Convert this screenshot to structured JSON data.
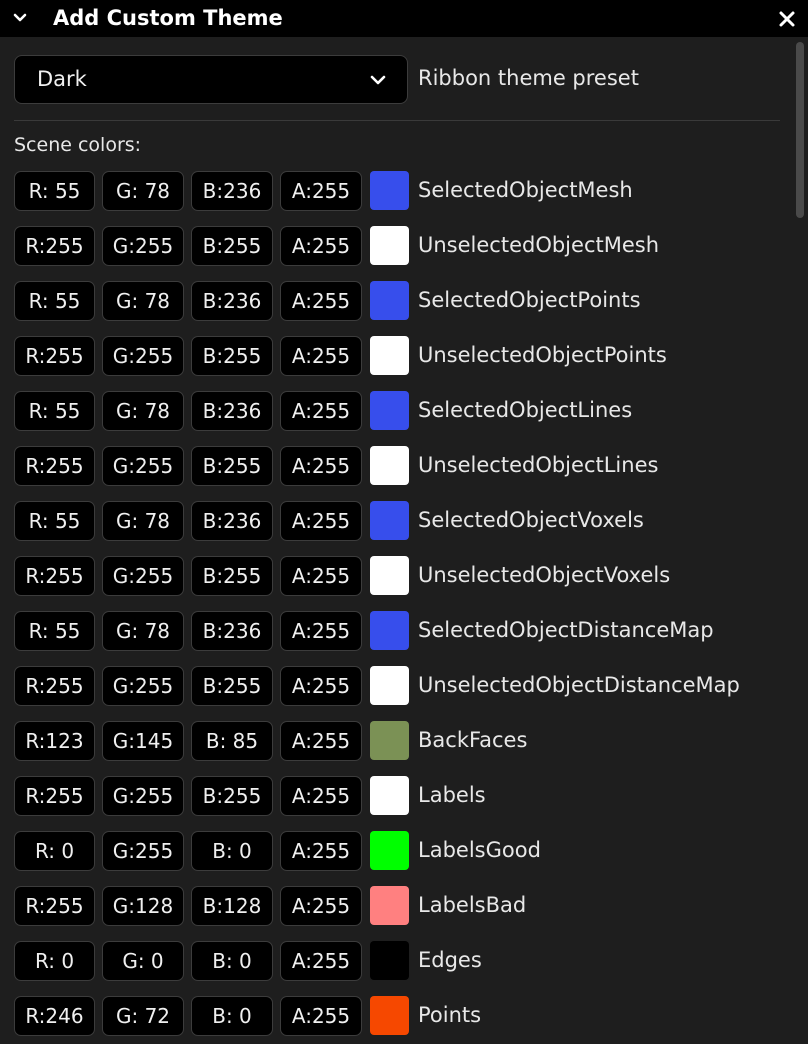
{
  "window": {
    "title": "Add Custom Theme"
  },
  "preset": {
    "value": "Dark",
    "label": "Ribbon theme preset"
  },
  "scene": {
    "label": "Scene colors:",
    "rows": [
      {
        "r": "R: 55",
        "g": "G: 78",
        "b": "B:236",
        "a": "A:255",
        "color": "#374eec",
        "name": "SelectedObjectMesh"
      },
      {
        "r": "R:255",
        "g": "G:255",
        "b": "B:255",
        "a": "A:255",
        "color": "#ffffff",
        "name": "UnselectedObjectMesh"
      },
      {
        "r": "R: 55",
        "g": "G: 78",
        "b": "B:236",
        "a": "A:255",
        "color": "#374eec",
        "name": "SelectedObjectPoints"
      },
      {
        "r": "R:255",
        "g": "G:255",
        "b": "B:255",
        "a": "A:255",
        "color": "#ffffff",
        "name": "UnselectedObjectPoints"
      },
      {
        "r": "R: 55",
        "g": "G: 78",
        "b": "B:236",
        "a": "A:255",
        "color": "#374eec",
        "name": "SelectedObjectLines"
      },
      {
        "r": "R:255",
        "g": "G:255",
        "b": "B:255",
        "a": "A:255",
        "color": "#ffffff",
        "name": "UnselectedObjectLines"
      },
      {
        "r": "R: 55",
        "g": "G: 78",
        "b": "B:236",
        "a": "A:255",
        "color": "#374eec",
        "name": "SelectedObjectVoxels"
      },
      {
        "r": "R:255",
        "g": "G:255",
        "b": "B:255",
        "a": "A:255",
        "color": "#ffffff",
        "name": "UnselectedObjectVoxels"
      },
      {
        "r": "R: 55",
        "g": "G: 78",
        "b": "B:236",
        "a": "A:255",
        "color": "#374eec",
        "name": "SelectedObjectDistanceMap"
      },
      {
        "r": "R:255",
        "g": "G:255",
        "b": "B:255",
        "a": "A:255",
        "color": "#ffffff",
        "name": "UnselectedObjectDistanceMap"
      },
      {
        "r": "R:123",
        "g": "G:145",
        "b": "B: 85",
        "a": "A:255",
        "color": "#7b9155",
        "name": "BackFaces"
      },
      {
        "r": "R:255",
        "g": "G:255",
        "b": "B:255",
        "a": "A:255",
        "color": "#ffffff",
        "name": "Labels"
      },
      {
        "r": "R: 0",
        "g": "G:255",
        "b": "B: 0",
        "a": "A:255",
        "color": "#00ff00",
        "name": "LabelsGood"
      },
      {
        "r": "R:255",
        "g": "G:128",
        "b": "B:128",
        "a": "A:255",
        "color": "#ff8080",
        "name": "LabelsBad"
      },
      {
        "r": "R: 0",
        "g": "G: 0",
        "b": "B: 0",
        "a": "A:255",
        "color": "#000000",
        "name": "Edges"
      },
      {
        "r": "R:246",
        "g": "G: 72",
        "b": "B: 0",
        "a": "A:255",
        "color": "#f64800",
        "name": "Points"
      }
    ]
  }
}
